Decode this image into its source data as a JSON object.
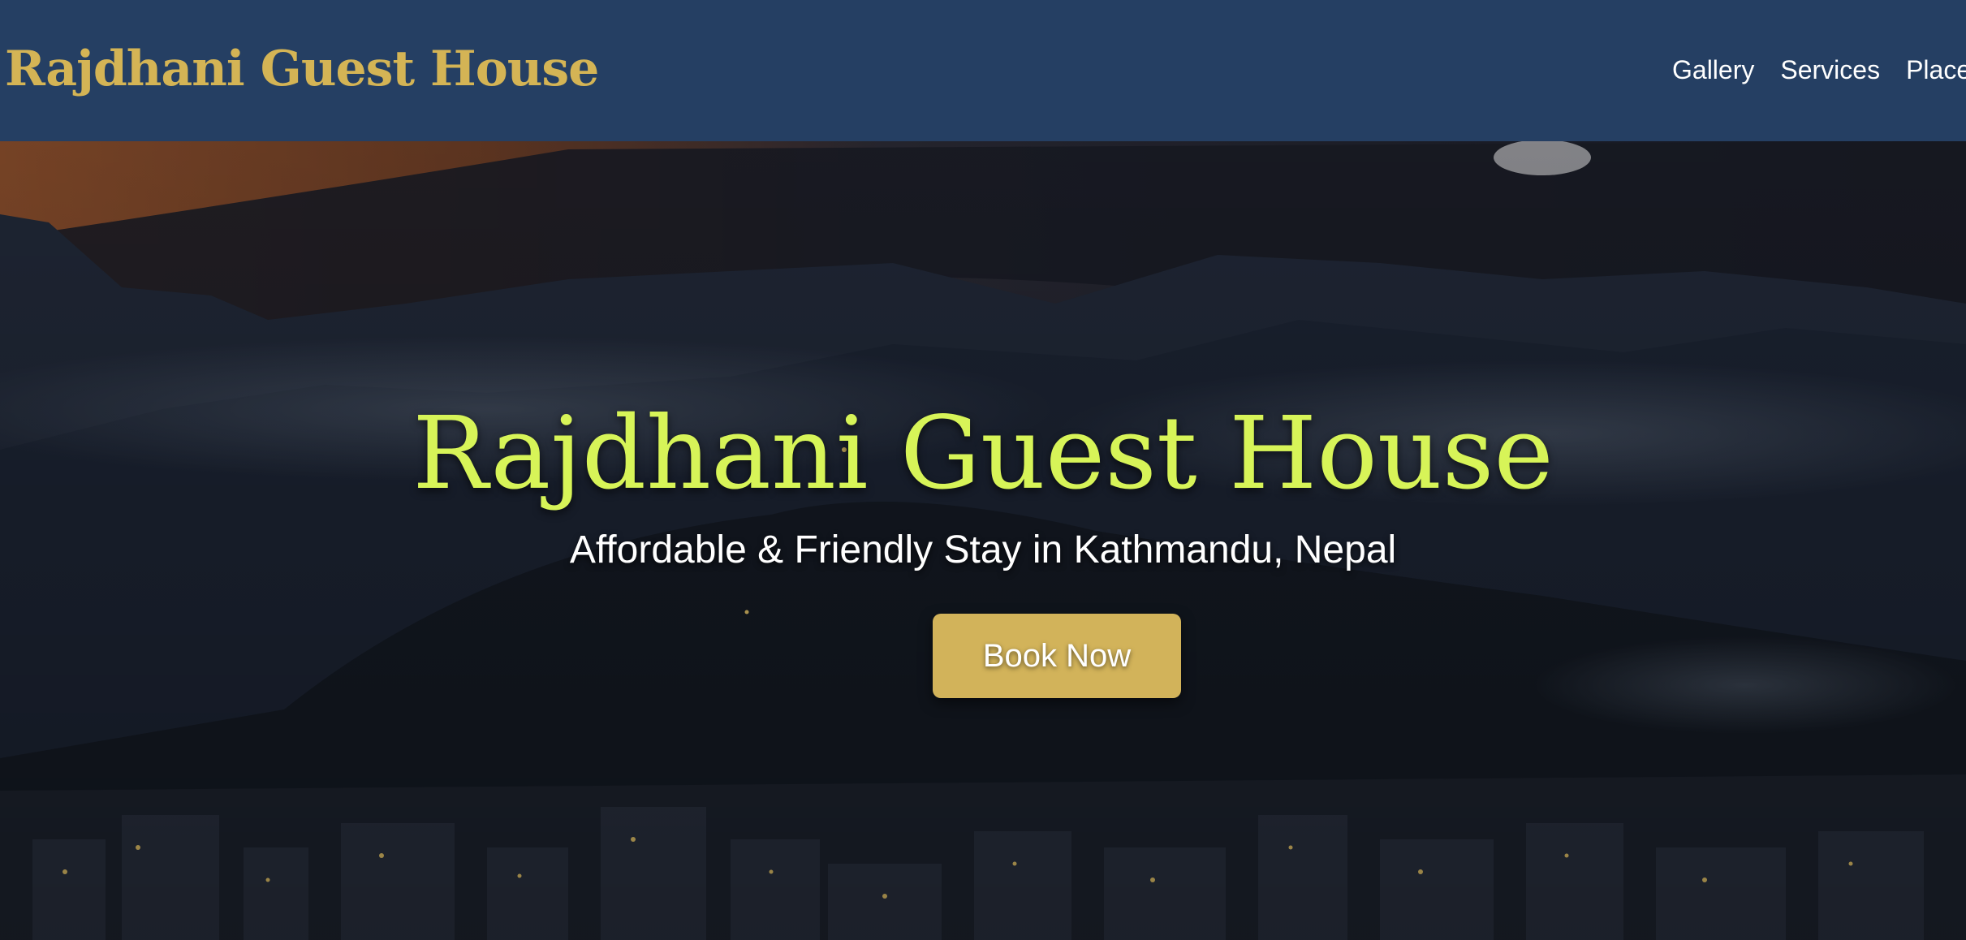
{
  "header": {
    "brand": "Rajdhani Guest House",
    "nav": [
      {
        "label": "Gallery"
      },
      {
        "label": "Services"
      },
      {
        "label": "Places"
      }
    ]
  },
  "hero": {
    "title": "Rajdhani Guest House",
    "subtitle": "Affordable & Friendly Stay in Kathmandu, Nepal",
    "cta_label": "Book Now"
  },
  "colors": {
    "header_bg": "#253f63",
    "brand": "#d4b455",
    "hero_title": "#d7f458",
    "button_bg": "#d2b35a"
  }
}
